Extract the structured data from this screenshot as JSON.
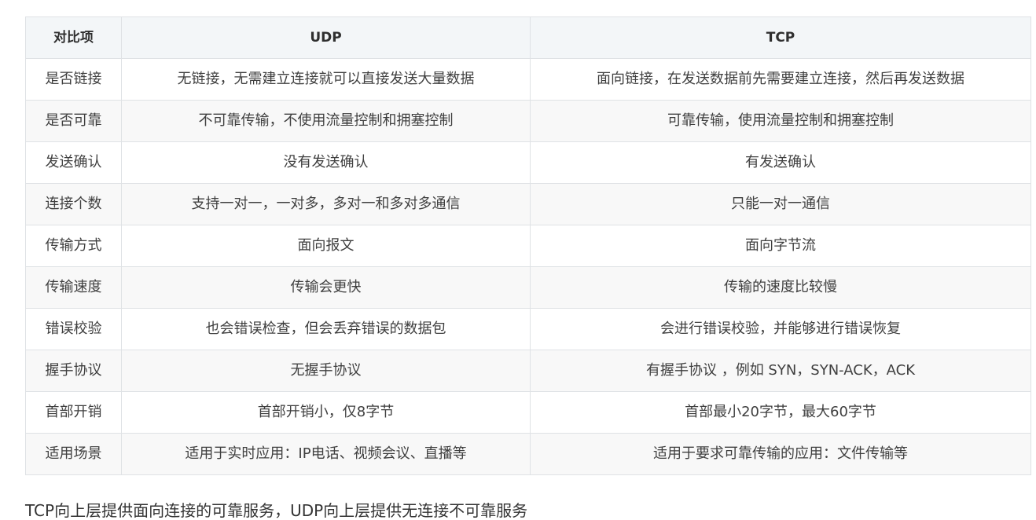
{
  "table": {
    "headers": [
      "对比项",
      "UDP",
      "TCP"
    ],
    "rows": [
      [
        "是否链接",
        "无链接，无需建立连接就可以直接发送大量数据",
        "面向链接，在发送数据前先需要建立连接，然后再发送数据"
      ],
      [
        "是否可靠",
        "不可靠传输，不使用流量控制和拥塞控制",
        "可靠传输，使用流量控制和拥塞控制"
      ],
      [
        "发送确认",
        "没有发送确认",
        "有发送确认"
      ],
      [
        "连接个数",
        "支持一对一，一对多，多对一和多对多通信",
        "只能一对一通信"
      ],
      [
        "传输方式",
        "面向报文",
        "面向字节流"
      ],
      [
        "传输速度",
        "传输会更快",
        "传输的速度比较慢"
      ],
      [
        "错误校验",
        "也会错误检查，但会丢弃错误的数据包",
        "会进行错误校验，并能够进行错误恢复"
      ],
      [
        "握手协议",
        "无握手协议",
        "有握手协议 ，例如 SYN，SYN-ACK，ACK"
      ],
      [
        "首部开销",
        "首部开销小，仅8字节",
        "首部最小20字节，最大60字节"
      ],
      [
        "适用场景",
        "适用于实时应用：IP电话、视频会议、直播等",
        "适用于要求可靠传输的应用：文件传输等"
      ]
    ]
  },
  "footer": {
    "text": "TCP向上层提供面向连接的可靠服务，UDP向上层提供无连接不可靠服务"
  }
}
